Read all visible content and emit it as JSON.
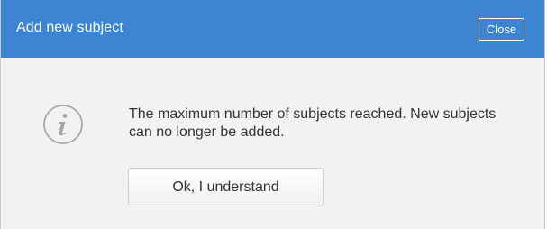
{
  "dialog": {
    "title": "Add new subject",
    "close_label": "Close",
    "message": "The maximum number of subjects reached. New subjects can no longer be added.",
    "ok_label": "Ok, I understand",
    "icon": "info-icon"
  },
  "colors": {
    "header": "#3c85d3",
    "body": "#f2f2f2",
    "text": "#333333"
  }
}
